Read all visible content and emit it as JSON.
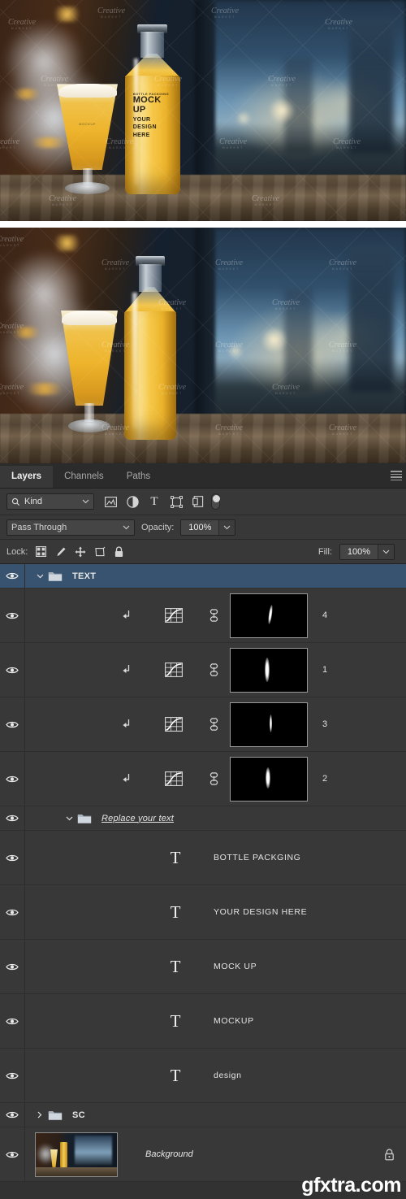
{
  "preview": {
    "bottle_label": {
      "line_small": "BOTTLE PACKGING",
      "line_big_1": "MOCK",
      "line_big_2": "UP",
      "line_mid_1": "YOUR",
      "line_mid_2": "DESIGN",
      "line_mid_3": "HERE"
    },
    "glass_label": "MOCKUP",
    "watermark": "Creative",
    "watermark_sub": "MARKET"
  },
  "panel": {
    "tabs": [
      {
        "label": "Layers",
        "active": true
      },
      {
        "label": "Channels",
        "active": false
      },
      {
        "label": "Paths",
        "active": false
      }
    ],
    "menu_icon": "hamburger-menu-icon",
    "filter": {
      "search_icon": "search-icon",
      "kind_label": "Kind",
      "chevron_icon": "chevron-down-icon",
      "icons": [
        "pixel-layer-filter-icon",
        "adjustment-layer-filter-icon",
        "type-layer-filter-icon",
        "shape-layer-filter-icon",
        "smart-object-filter-icon"
      ],
      "toggle_icon": "filter-toggle-switch"
    },
    "blend": {
      "mode": "Pass Through",
      "opacity_label": "Opacity:",
      "opacity_value": "100%",
      "fill_label": "Fill:",
      "fill_value": "100%"
    },
    "lock": {
      "label": "Lock:",
      "icons": [
        "lock-transparent-pixels-icon",
        "lock-image-pixels-icon",
        "lock-position-icon",
        "lock-artboard-nesting-icon",
        "lock-all-icon"
      ]
    },
    "layers": [
      {
        "type": "group",
        "name": "TEXT",
        "expanded": true,
        "selected": true,
        "indent": 0,
        "visible": true
      },
      {
        "type": "adjustment",
        "name": "4",
        "indent": 1,
        "visible": true,
        "clipped": true,
        "linked": true
      },
      {
        "type": "adjustment",
        "name": "1",
        "indent": 1,
        "visible": true,
        "clipped": true,
        "linked": true
      },
      {
        "type": "adjustment",
        "name": "3",
        "indent": 1,
        "visible": true,
        "clipped": true,
        "linked": true
      },
      {
        "type": "adjustment",
        "name": "2",
        "indent": 1,
        "visible": true,
        "clipped": true,
        "linked": true
      },
      {
        "type": "group",
        "name": "Replace your text",
        "expanded": true,
        "selected": false,
        "indent": 1,
        "visible": true
      },
      {
        "type": "text",
        "name": "BOTTLE PACKGING",
        "indent": 2,
        "visible": true
      },
      {
        "type": "text",
        "name": "YOUR DESIGN HERE",
        "indent": 2,
        "visible": true
      },
      {
        "type": "text",
        "name": "MOCK UP",
        "indent": 2,
        "visible": true
      },
      {
        "type": "text",
        "name": "MOCKUP",
        "indent": 2,
        "visible": true
      },
      {
        "type": "text",
        "name": "design",
        "indent": 2,
        "visible": true
      },
      {
        "type": "group",
        "name": "SC",
        "expanded": false,
        "selected": false,
        "indent": 0,
        "visible": true
      },
      {
        "type": "background",
        "name": "Background",
        "indent": 0,
        "visible": true,
        "locked": true
      }
    ]
  },
  "watermark_overlay": "gfxtra.com",
  "colors": {
    "panel_bg": "#383838",
    "tabbar_bg": "#2b2b2b",
    "selected_row": "#37536f",
    "text": "#e6e6e6"
  }
}
